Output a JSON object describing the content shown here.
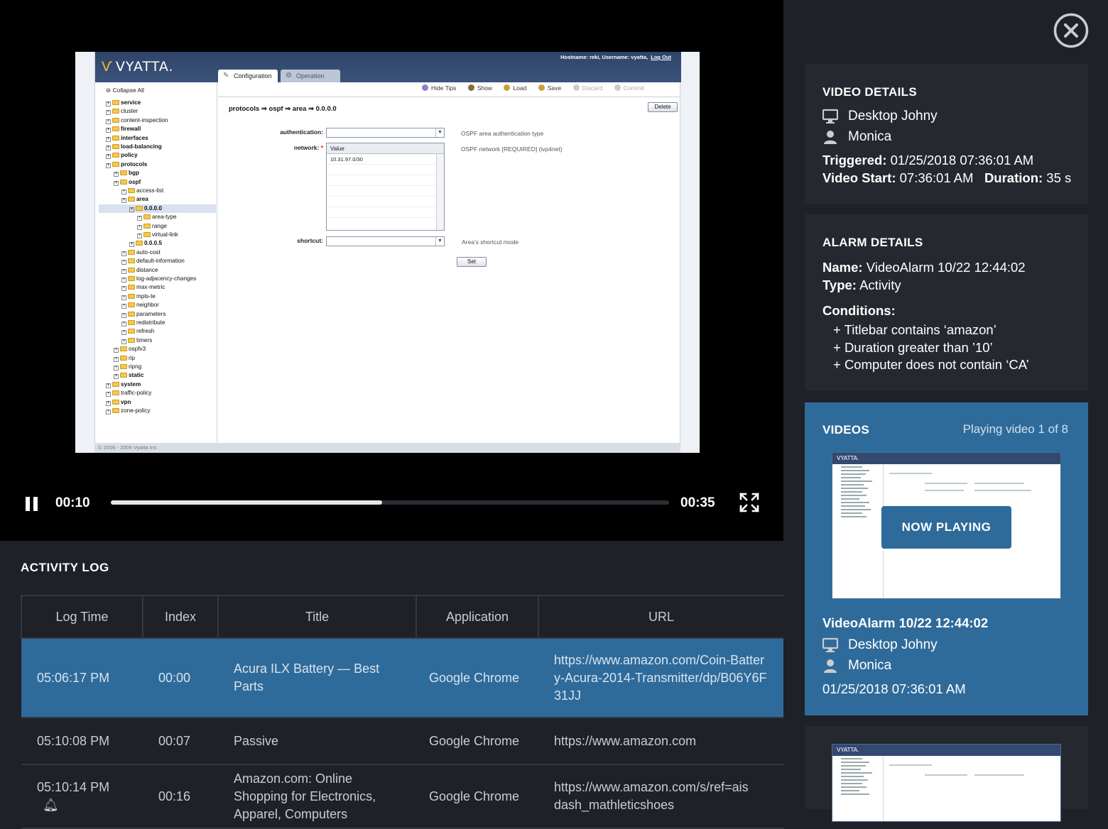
{
  "player": {
    "current_time": "00:10",
    "total_time": "00:35",
    "progress": 0.486,
    "screen": {
      "logo": "VYATTA.",
      "user_info": "Hostname: reki,  Username: vyatta,",
      "logout": "Log Out",
      "tabs": [
        "Configuration",
        "Operation"
      ],
      "collapse_all": "Collapse All",
      "toolbar": [
        "Hide Tips",
        "Show",
        "Load",
        "Save",
        "Discard",
        "Commit"
      ],
      "path": "protocols ⇒ ospf ⇒ area ⇒ 0.0.0.0",
      "delete": "Delete",
      "auth_label": "authentication:",
      "auth_hint": "OSPF area authentication type",
      "network_label": "network:",
      "network_hint": "OSPF network [REQUIRED] (ivp4net)",
      "list_header": "Value",
      "list_value": "10.31.97.0/30",
      "shortcut_label": "shortcut:",
      "shortcut_hint": "Area's shortcut mode",
      "set": "Set",
      "footer": "© 2006 - 2009 Vyatta Inc.",
      "tree": [
        {
          "t": "service",
          "d": 0,
          "b": true
        },
        {
          "t": "cluster",
          "d": 0
        },
        {
          "t": "content-inspection",
          "d": 0
        },
        {
          "t": "firewall",
          "d": 0,
          "b": true
        },
        {
          "t": "interfaces",
          "d": 0,
          "b": true
        },
        {
          "t": "load-balancing",
          "d": 0,
          "b": true
        },
        {
          "t": "policy",
          "d": 0,
          "b": true
        },
        {
          "t": "protocols",
          "d": 0,
          "b": true
        },
        {
          "t": "bgp",
          "d": 1,
          "b": true
        },
        {
          "t": "ospf",
          "d": 1,
          "b": true
        },
        {
          "t": "access-list",
          "d": 2
        },
        {
          "t": "area",
          "d": 2,
          "b": true
        },
        {
          "t": "0.0.0.0",
          "d": 3,
          "b": true,
          "sel": true
        },
        {
          "t": "area-type",
          "d": 4
        },
        {
          "t": "range",
          "d": 4
        },
        {
          "t": "virtual-link",
          "d": 4
        },
        {
          "t": "0.0.0.5",
          "d": 3,
          "b": true
        },
        {
          "t": "auto-cost",
          "d": 2
        },
        {
          "t": "default-information",
          "d": 2
        },
        {
          "t": "distance",
          "d": 2
        },
        {
          "t": "log-adjacency-changes",
          "d": 2
        },
        {
          "t": "max-metric",
          "d": 2
        },
        {
          "t": "mpls-te",
          "d": 2
        },
        {
          "t": "neighbor",
          "d": 2
        },
        {
          "t": "parameters",
          "d": 2
        },
        {
          "t": "redistribute",
          "d": 2
        },
        {
          "t": "refresh",
          "d": 2
        },
        {
          "t": "timers",
          "d": 2
        },
        {
          "t": "ospfv3",
          "d": 1
        },
        {
          "t": "rip",
          "d": 1
        },
        {
          "t": "ripng",
          "d": 1
        },
        {
          "t": "static",
          "d": 1,
          "b": true
        },
        {
          "t": "system",
          "d": 0,
          "b": true
        },
        {
          "t": "traffic-policy",
          "d": 0
        },
        {
          "t": "vpn",
          "d": 0,
          "b": true
        },
        {
          "t": "zone-policy",
          "d": 0
        }
      ]
    }
  },
  "activity_log": {
    "title": "ACTIVITY LOG",
    "columns": [
      "Log Time",
      "Index",
      "Title",
      "Application",
      "URL"
    ],
    "rows": [
      {
        "time": "05:06:17 PM",
        "index": "00:00",
        "title": "Acura ILX Battery — Best Parts",
        "app": "Google Chrome",
        "url": "https://www.amazon.com/Coin-Battery-Acura-2014-Transmitter/dp/B06Y6F31JJ"
      },
      {
        "time": "05:10:08 PM",
        "index": "00:07",
        "title": "Passive",
        "app": "Google Chrome",
        "url": "https://www.amazon.com"
      },
      {
        "time": "05:10:14 PM",
        "index": "00:16",
        "title": "Amazon.com: Online Shopping for Electronics, Apparel, Computers",
        "app": "Google Chrome",
        "url": "https://www.amazon.com/s/ref=ais dash_mathleticshoes"
      }
    ]
  },
  "video_details": {
    "title": "VIDEO DETAILS",
    "computer": "Desktop Johny",
    "user": "Monica",
    "triggered_label": "Triggered:",
    "triggered": "01/25/2018 07:36:01 AM",
    "start_label": "Video Start:",
    "start": "07:36:01 AM",
    "duration_label": "Duration:",
    "duration": "35 s"
  },
  "alarm_details": {
    "title": "ALARM DETAILS",
    "name_label": "Name:",
    "name": "VideoAlarm 10/22 12:44:02",
    "type_label": "Type:",
    "type": "Activity",
    "conditions_label": "Conditions:",
    "conditions": [
      "+ Titlebar contains ‘amazon’",
      "+ Duration greater than ’10’",
      "+ Computer does not contain ‘CA’"
    ]
  },
  "videos": {
    "title": "VIDEOS",
    "playing": "Playing video 1 of 8",
    "now_playing": "NOW PLAYING",
    "item_title": "VideoAlarm 10/22 12:44:02",
    "computer": "Desktop Johny",
    "user": "Monica",
    "date": "01/25/2018 07:36:01 AM",
    "thumb_logo": "VYATTA."
  },
  "colors": {
    "accent": "#2f6b9a",
    "panel": "#25282e",
    "background": "#1e2127"
  }
}
